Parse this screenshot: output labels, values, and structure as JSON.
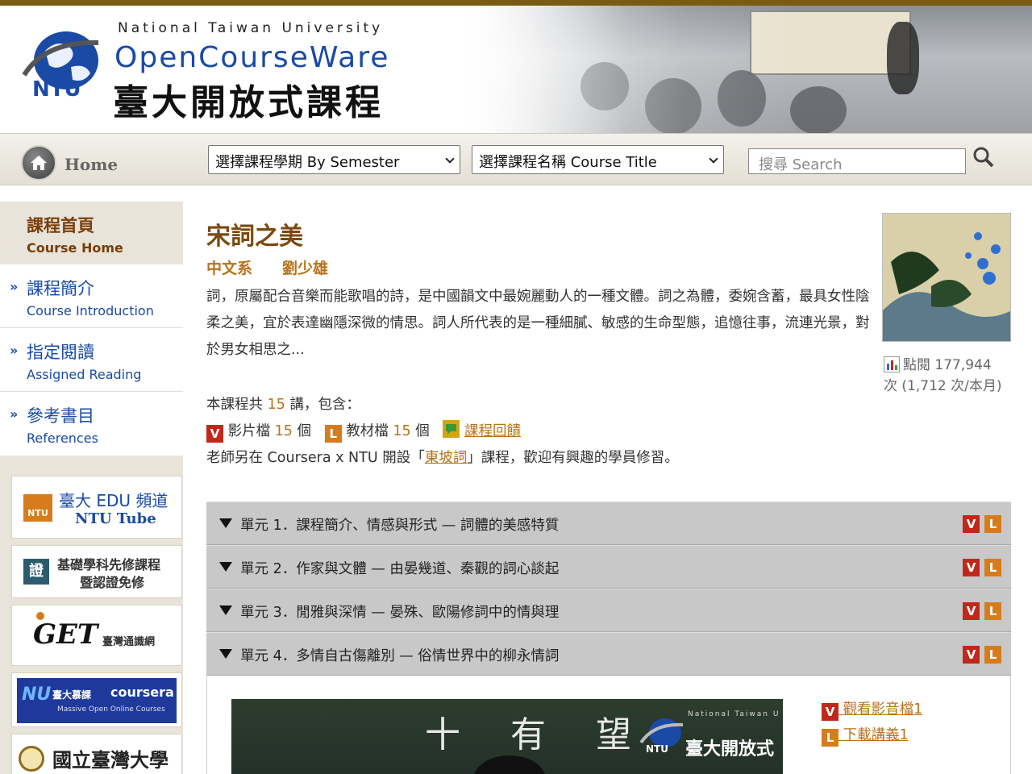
{
  "header": {
    "brand_en_line1": "National Taiwan University",
    "brand_en_line2": "OpenCourseWare",
    "brand_zh": "臺大開放式課程",
    "logo_abbr": "NTU"
  },
  "navbar": {
    "home_label": "Home",
    "semester_select": "選擇課程學期 By Semester",
    "course_select": "選擇課程名稱 Course Title",
    "search_placeholder": "搜尋 Search"
  },
  "sidebar": {
    "active": {
      "zh": "課程首頁",
      "en": "Course Home"
    },
    "items": [
      {
        "zh": "課程簡介",
        "en": "Course Introduction"
      },
      {
        "zh": "指定閱讀",
        "en": "Assigned Reading"
      },
      {
        "zh": "參考書目",
        "en": "References"
      }
    ],
    "bullet": "»",
    "banners": {
      "ntutube_zh": "臺大 EDU 頻道",
      "ntutube_en": "NTU Tube",
      "ntutube_badge": "NTU",
      "basic_line1": "基礎學科先修課程",
      "basic_line2": "暨認證免修",
      "basic_badge": "證",
      "get_logo": "GET",
      "get_zh": "臺灣通識網",
      "coursera_zh": "臺大慕課",
      "coursera_brand": "coursera",
      "coursera_sub": "Massive Open Online Courses",
      "ntu_name": "國立臺灣大學"
    }
  },
  "course": {
    "title": "宋詞之美",
    "department": "中文系",
    "teacher": "劉少雄",
    "description": "詞，原屬配合音樂而能歌唱的詩，是中國韻文中最婉麗動人的一種文體。詞之為體，委婉含蓄，最具女性陰柔之美，宜於表達幽隱深微的情思。詞人所代表的是一種細膩、敏感的生命型態，追憶往事，流連光景，對於男女相思之...",
    "views_label": "點閱",
    "views_value": "177,944",
    "views_unit": "次",
    "views_month": "(1,712 次/本月)",
    "summary_prefix": "本課程共",
    "summary_count": "15",
    "summary_suffix": "講，包含：",
    "video_badge": "V",
    "lecture_badge": "L",
    "video_label": "影片檔",
    "video_count": "15",
    "lecture_label": "教材檔",
    "lecture_count": "15",
    "count_unit": "個",
    "feedback_label": "課程回饋",
    "coursera_prefix": "老師另在 Coursera x NTU 開設「",
    "coursera_course": "東坡詞",
    "coursera_suffix": "」課程，歡迎有興趣的學員修習。"
  },
  "units": [
    {
      "label": "單元 1．課程簡介、情感與形式 — 詞體的美感特質"
    },
    {
      "label": "單元 2．作家與文體 — 由晏幾道、秦觀的詞心談起"
    },
    {
      "label": "單元 3．閒雅與深情 — 晏殊、歐陽修詞中的情與理"
    },
    {
      "label": "單元 4．多情自古傷離別 — 俗情世界中的柳永情詞"
    }
  ],
  "unit_open": {
    "video_link": "觀看影音檔1",
    "lecture_link": "下載講義1",
    "video_logo_en": "National Taiwan U",
    "video_logo_zh": "臺大開放式",
    "video_logo_abbr": "NTU",
    "chalk_text": "十 有 望"
  },
  "colors": {
    "accent": "#b8711a",
    "link_blue": "#1a4aa6",
    "title_brown": "#7a4a10",
    "video_red": "#c0281c",
    "lecture_orange": "#d67c1c"
  },
  "icons": {
    "home": "home-icon",
    "search": "search-icon",
    "views": "bar-chart-icon",
    "feedback": "speech-bubble-icon"
  }
}
